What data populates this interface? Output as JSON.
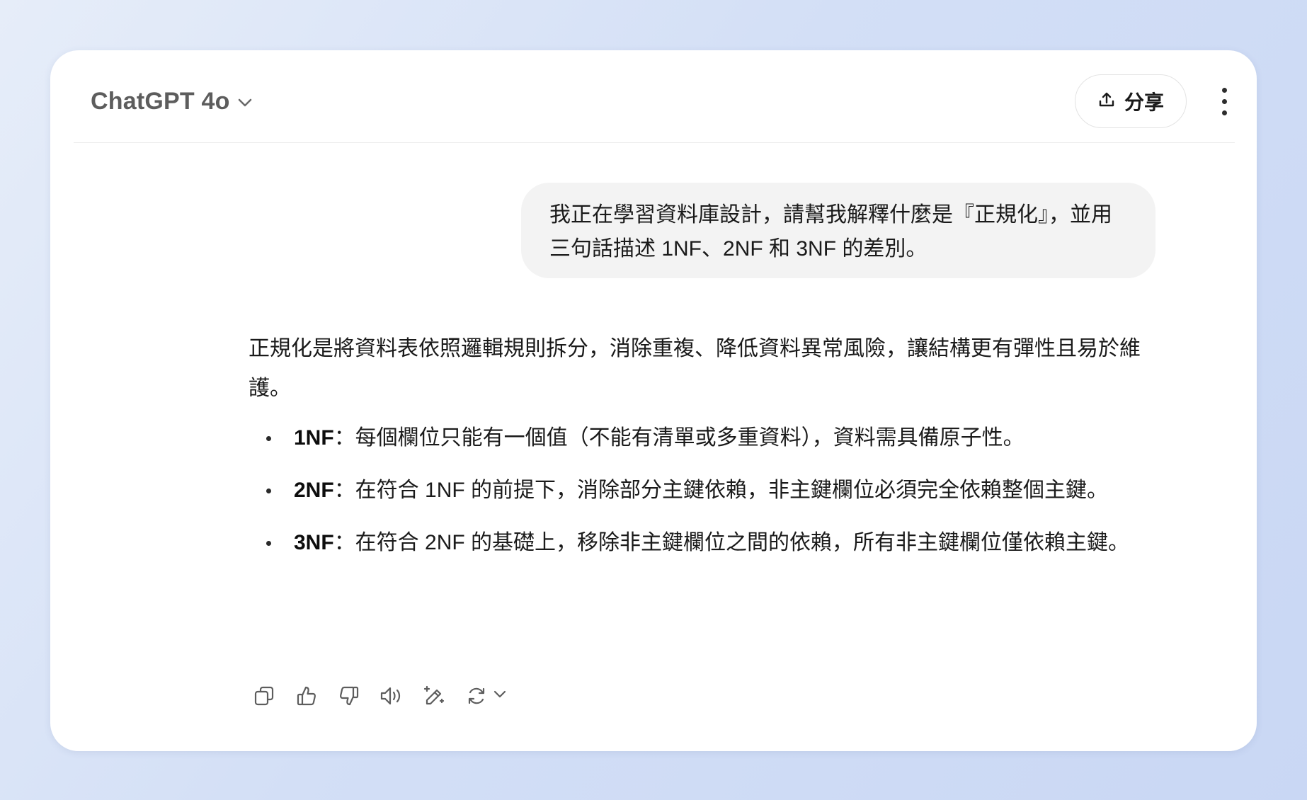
{
  "header": {
    "model_name": "ChatGPT 4o",
    "share_label": "分享"
  },
  "conversation": {
    "user_message": "我正在學習資料庫設計，請幫我解釋什麼是『正規化』，並用三句話描述 1NF、2NF 和 3NF 的差別。",
    "assistant": {
      "intro": "正規化是將資料表依照邏輯規則拆分，消除重複、降低資料異常風險，讓結構更有彈性且易於維護。",
      "bullets": [
        {
          "term": "1NF",
          "text": "：每個欄位只能有一個值（不能有清單或多重資料），資料需具備原子性。"
        },
        {
          "term": "2NF",
          "text": "：在符合 1NF 的前提下，消除部分主鍵依賴，非主鍵欄位必須完全依賴整個主鍵。"
        },
        {
          "term": "3NF",
          "text": "：在符合 2NF 的基礎上，移除非主鍵欄位之間的依賴，所有非主鍵欄位僅依賴主鍵。"
        }
      ]
    }
  },
  "actions": {
    "icons": [
      "copy-icon",
      "thumbs-up-icon",
      "thumbs-down-icon",
      "read-aloud-icon",
      "edit-sparkle-icon",
      "regenerate-icon",
      "chevron-down-icon"
    ]
  },
  "colors": {
    "background": "#d3dff6",
    "card": "#ffffff",
    "user_bubble": "#f3f3f3",
    "model_name": "#5d5d5d",
    "text": "#1a1a1a"
  }
}
